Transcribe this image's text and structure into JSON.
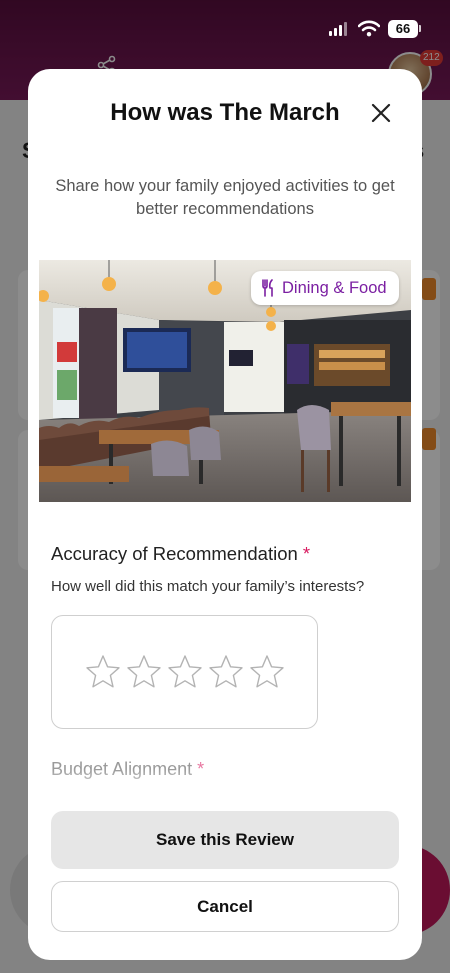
{
  "status_bar": {
    "battery": "66"
  },
  "background": {
    "letter_left": "S",
    "letter_right": "s",
    "notification_count": "212"
  },
  "review_modal": {
    "title": "How was The March",
    "subtitle": "Share how your family enjoyed activities to get better recommendations",
    "category_chip": {
      "label": "Dining & Food",
      "icon": "fork-knife-icon",
      "color": "#7b1fa2"
    },
    "accuracy": {
      "label": "Accuracy of Recommendation",
      "required_mark": "*",
      "help": "How well did this match your family’s interests?",
      "rating": 0,
      "max_rating": 5
    },
    "budget": {
      "label": "Budget Alignment",
      "required_mark": "*"
    },
    "save_label": "Save this Review",
    "cancel_label": "Cancel"
  }
}
